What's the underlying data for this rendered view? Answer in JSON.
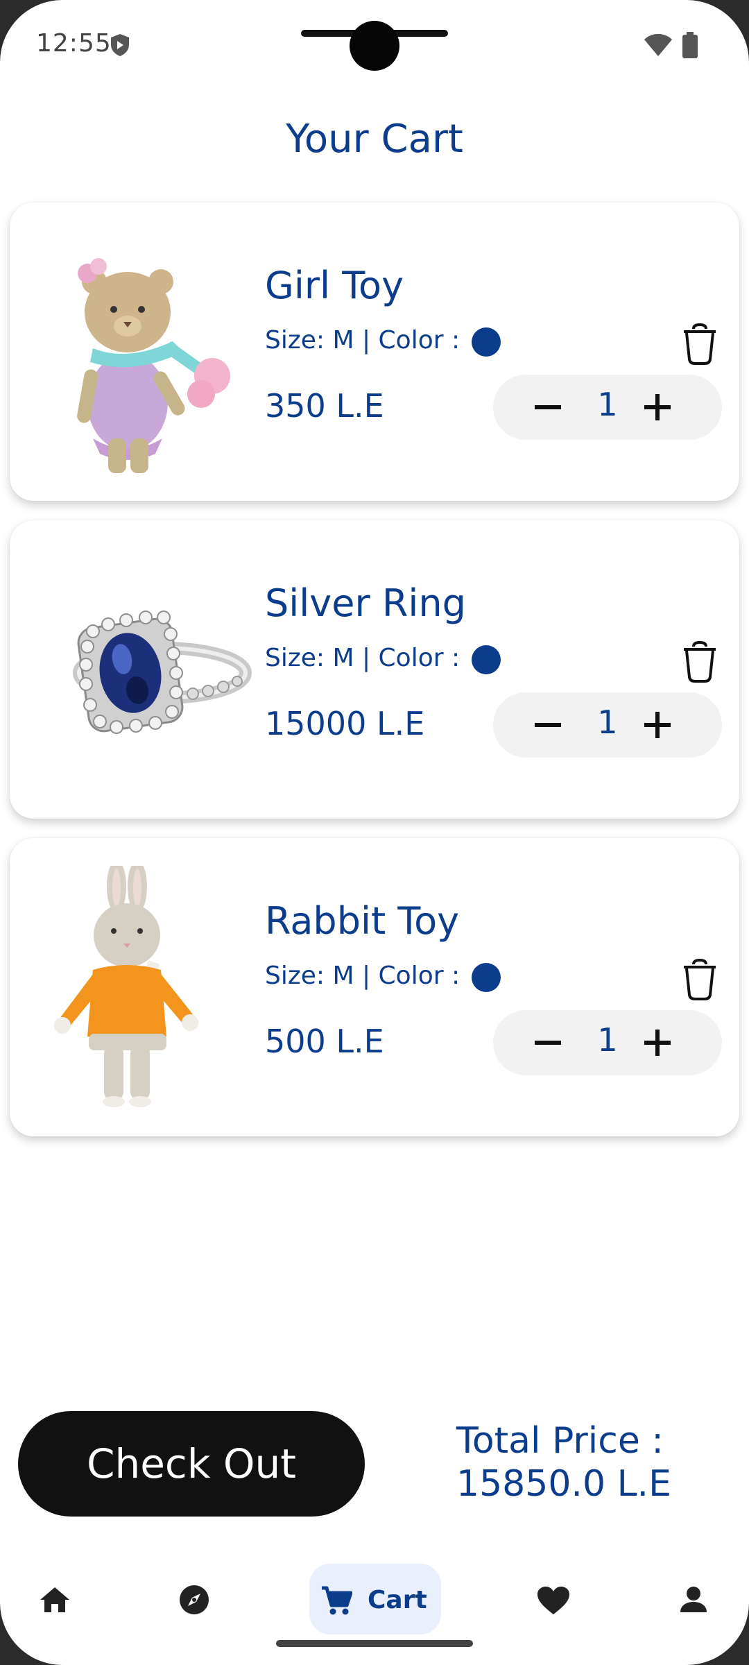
{
  "status_bar": {
    "time": "12:55"
  },
  "page": {
    "title": "Your Cart"
  },
  "cart_items": [
    {
      "name": "Girl Toy",
      "meta": "Size: M | Color :",
      "price": "350 L.E",
      "quantity": "1",
      "color": "#0b3d8c",
      "thumbnail": "crochet-girl-bear-toy"
    },
    {
      "name": "Silver Ring",
      "meta": "Size: M | Color :",
      "price": "15000 L.E",
      "quantity": "1",
      "color": "#0b3d8c",
      "thumbnail": "silver-sapphire-ring"
    },
    {
      "name": "Rabbit Toy",
      "meta": "Size: M | Color :",
      "price": "500 L.E",
      "quantity": "1",
      "color": "#0b3d8c",
      "thumbnail": "crochet-rabbit-toy"
    }
  ],
  "footer": {
    "checkout_label": "Check Out",
    "total_label": "Total Price :",
    "total_value": "15850.0 L.E"
  },
  "bottom_nav": {
    "items": [
      {
        "icon": "home-icon"
      },
      {
        "icon": "compass-icon"
      },
      {
        "icon": "cart-icon",
        "label": "Cart",
        "active": true
      },
      {
        "icon": "heart-icon"
      },
      {
        "icon": "person-icon"
      }
    ]
  },
  "colors": {
    "primary": "#0b3d8c",
    "dark": "#111111",
    "active_nav_bg": "#e9f0fb"
  }
}
